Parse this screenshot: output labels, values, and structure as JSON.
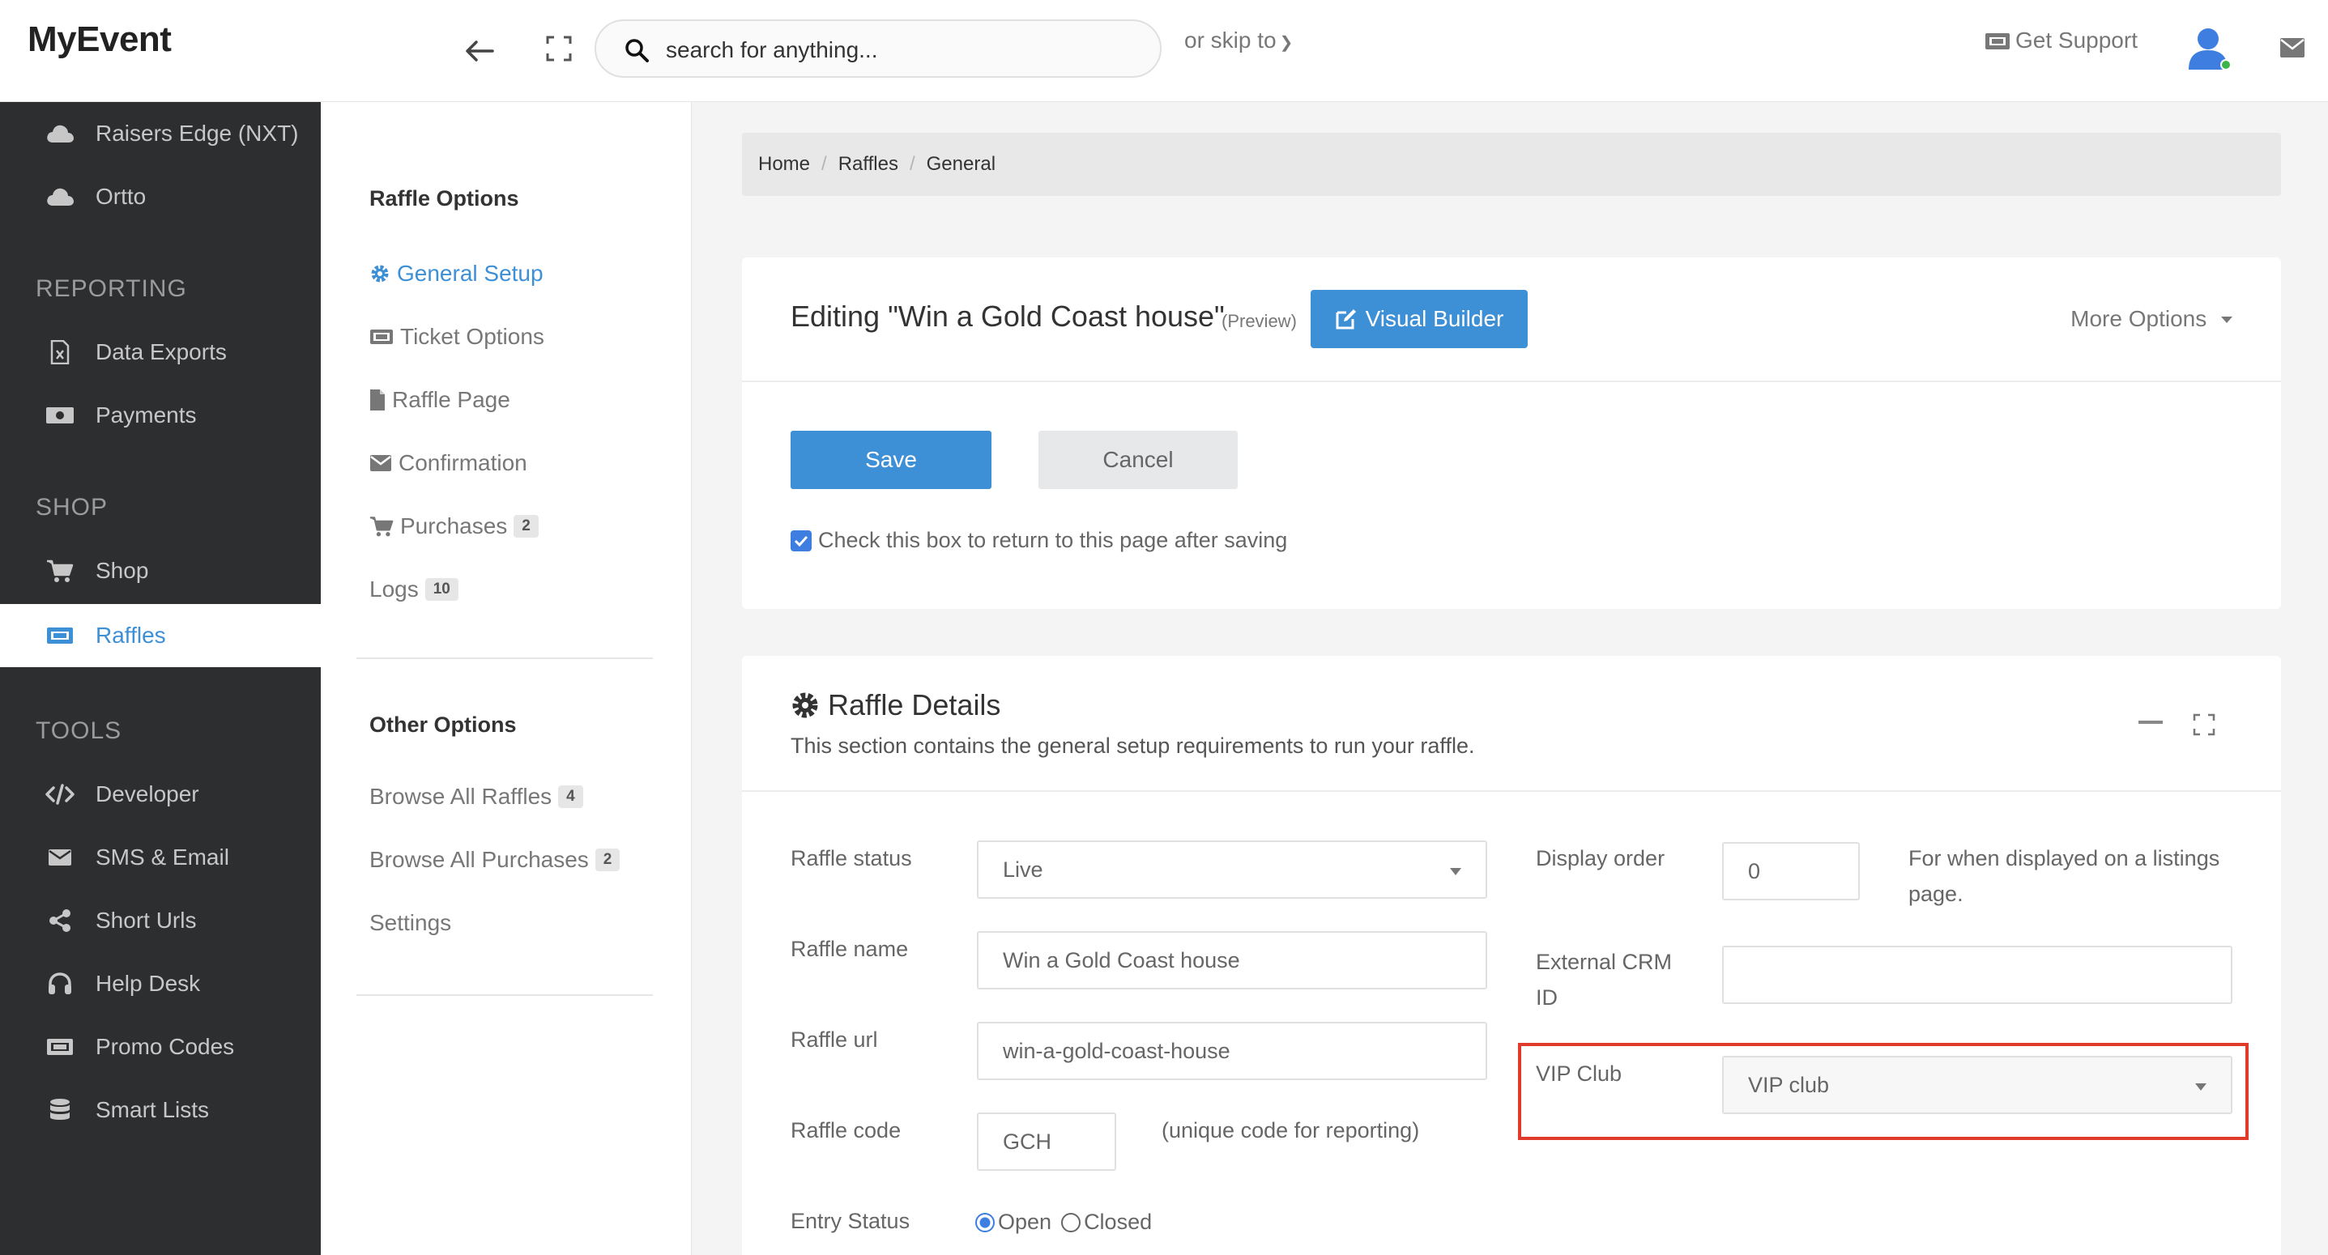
{
  "app": {
    "title": "MyEvent"
  },
  "search": {
    "placeholder": "search for anything..."
  },
  "header": {
    "skip_label": "or skip to",
    "support_label": "Get Support"
  },
  "sidebar": {
    "items_top": [
      {
        "label": "Raisers Edge (NXT)",
        "icon": "cloud-icon"
      },
      {
        "label": "Ortto",
        "icon": "cloud-icon"
      }
    ],
    "sections": [
      {
        "heading": "REPORTING",
        "items": [
          {
            "label": "Data Exports",
            "icon": "file-excel-icon"
          },
          {
            "label": "Payments",
            "icon": "money-icon"
          }
        ]
      },
      {
        "heading": "SHOP",
        "items": [
          {
            "label": "Shop",
            "icon": "cart-icon"
          },
          {
            "label": "Raffles",
            "icon": "ticket-icon",
            "active": true
          }
        ]
      },
      {
        "heading": "TOOLS",
        "items": [
          {
            "label": "Developer",
            "icon": "code-icon"
          },
          {
            "label": "SMS & Email",
            "icon": "envelope-icon"
          },
          {
            "label": "Short Urls",
            "icon": "share-icon"
          },
          {
            "label": "Help Desk",
            "icon": "headset-icon"
          },
          {
            "label": "Promo Codes",
            "icon": "ticket-icon"
          },
          {
            "label": "Smart Lists",
            "icon": "database-icon"
          }
        ]
      }
    ]
  },
  "subnav": {
    "raffle_options_title": "Raffle Options",
    "raffle_options": [
      {
        "label": "General Setup",
        "icon": "cog-icon",
        "active": true
      },
      {
        "label": "Ticket Options",
        "icon": "ticket-icon"
      },
      {
        "label": "Raffle Page",
        "icon": "file-icon"
      },
      {
        "label": "Confirmation",
        "icon": "envelope-icon"
      },
      {
        "label": "Purchases",
        "icon": "cart-icon",
        "badge": "2"
      },
      {
        "label": "Logs",
        "badge": "10"
      }
    ],
    "other_options_title": "Other Options",
    "other_options": [
      {
        "label": "Browse All Raffles",
        "badge": "4"
      },
      {
        "label": "Browse All Purchases",
        "badge": "2"
      },
      {
        "label": "Settings"
      }
    ]
  },
  "breadcrumb": [
    "Home",
    "Raffles",
    "General"
  ],
  "editor": {
    "title": "Editing \"Win a Gold Coast house\"",
    "preview_label": "(Preview)",
    "visual_builder_label": "Visual Builder",
    "more_options_label": "More Options",
    "save_label": "Save",
    "cancel_label": "Cancel",
    "return_checkbox_label": "Check this box to return to this page after saving",
    "return_checked": true
  },
  "raffle_details": {
    "title": "Raffle Details",
    "description": "This section contains the general setup requirements to run your raffle.",
    "fields": {
      "status_label": "Raffle status",
      "status_value": "Live",
      "name_label": "Raffle name",
      "name_value": "Win a Gold Coast house",
      "url_label": "Raffle url",
      "url_value": "win-a-gold-coast-house",
      "code_label": "Raffle code",
      "code_value": "GCH",
      "code_hint": "(unique code for reporting)",
      "entry_label": "Entry Status",
      "entry_open": "Open",
      "entry_closed": "Closed",
      "display_order_label": "Display order",
      "display_order_value": "0",
      "display_order_hint": "For when displayed on a listings page.",
      "crm_label": "External CRM ID",
      "crm_value": "",
      "vip_label": "VIP Club",
      "vip_value": "VIP club"
    }
  },
  "colors": {
    "accent": "#3d8fd6",
    "sidebar_bg": "#2d2e30",
    "highlight": "#e03a2b"
  }
}
